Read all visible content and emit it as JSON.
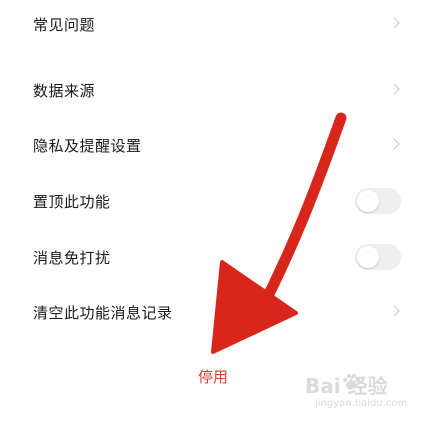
{
  "settings": {
    "items": [
      {
        "label": "常见问题",
        "control": "chevron"
      },
      {
        "label": "数据来源",
        "control": "chevron"
      },
      {
        "label": "隐私及提醒设置",
        "control": "chevron"
      },
      {
        "label": "置顶此功能",
        "control": "toggle",
        "on": false
      },
      {
        "label": "消息免打扰",
        "control": "toggle",
        "on": false
      },
      {
        "label": "清空此功能消息记录",
        "control": "chevron"
      }
    ]
  },
  "disable_button": {
    "label": "停用",
    "color": "#e03a2f"
  },
  "annotation": {
    "arrow_color": "#d9261c"
  },
  "watermark": {
    "text": "Bai 经验",
    "url": "jingyan.baidu.com"
  }
}
